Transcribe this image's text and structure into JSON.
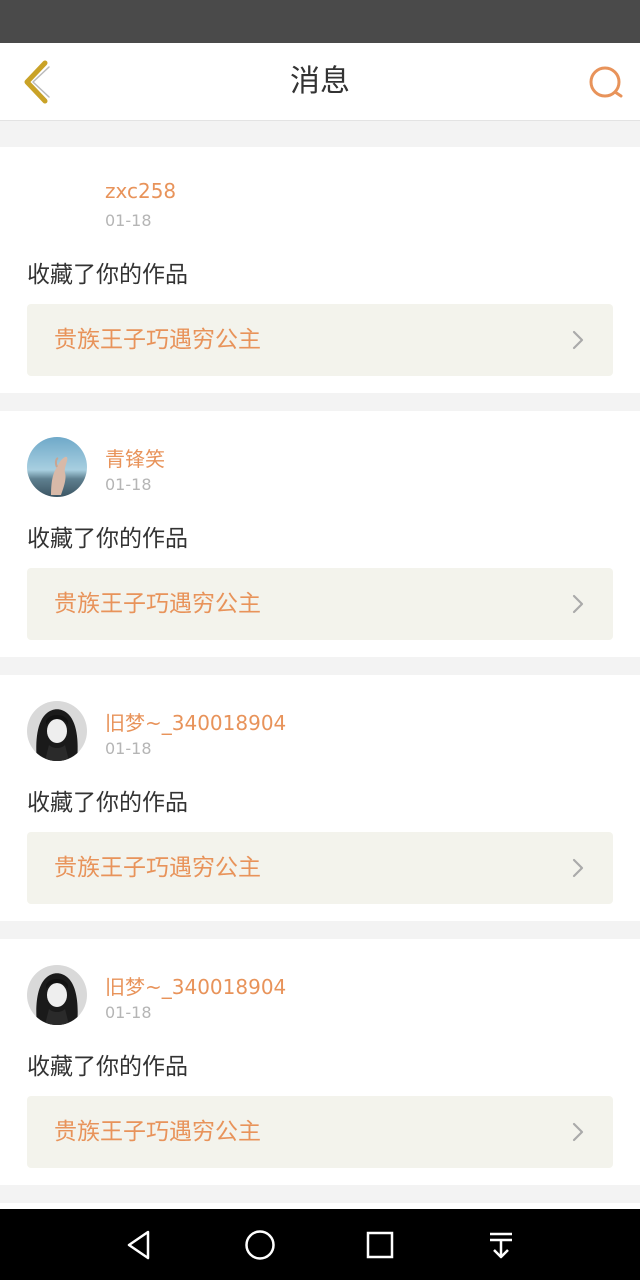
{
  "header": {
    "title": "消息",
    "back_icon": "chevron-left-icon",
    "search_icon": "search-icon"
  },
  "colors": {
    "accent": "#e8935a",
    "back_icon": "#c9a227",
    "text": "#333333",
    "muted": "#b5b5b5",
    "work_bg": "#f3f3ec",
    "page_bg": "#f3f3f3",
    "nav_bar": "#000000",
    "status_bar": "#4a4a4a"
  },
  "messages": [
    {
      "username": "zxc258",
      "date": "01-18",
      "action": "收藏了你的作品",
      "work_title": "贵族王子巧遇穷公主",
      "avatar": "blank"
    },
    {
      "username": "青锋笑",
      "date": "01-18",
      "action": "收藏了你的作品",
      "work_title": "贵族王子巧遇穷公主",
      "avatar": "hand-sky-photo"
    },
    {
      "username": "旧梦~_340018904",
      "date": "01-18",
      "action": "收藏了你的作品",
      "work_title": "贵族王子巧遇穷公主",
      "avatar": "dark-hair-girl-photo"
    },
    {
      "username": "旧梦~_340018904",
      "date": "01-18",
      "action": "收藏了你的作品",
      "work_title": "贵族王子巧遇穷公主",
      "avatar": "dark-hair-girl-photo"
    }
  ],
  "navbar": {
    "back": "triangle-back-icon",
    "home": "circle-home-icon",
    "recents": "square-recents-icon",
    "notifications": "pull-down-icon"
  }
}
